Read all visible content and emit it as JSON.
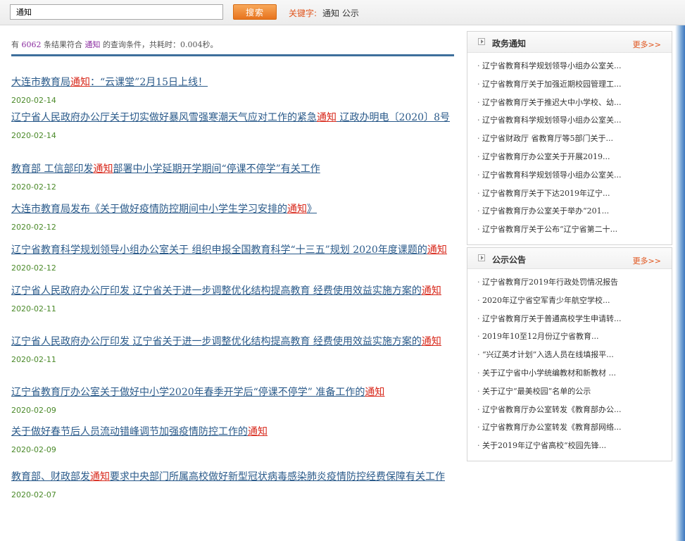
{
  "search": {
    "value": "通知",
    "button_label": "搜索",
    "keyword_label": "关键字:",
    "keyword_value": "通知 公示"
  },
  "summary": {
    "prefix": "有",
    "count": "6062",
    "middle": "条结果符合",
    "keyword": "通知",
    "suffix": "的查询条件，共耗时：0.004秒。"
  },
  "results": [
    {
      "pre": "大连市教育局",
      "hl": "通知",
      "post": "：“云课堂”2月15日上线！",
      "date": "2020-02-14"
    },
    {
      "pre": "辽宁省人民政府办公厅关于切实做好暴风雪强寒潮天气应对工作的紧急",
      "hl": "通知",
      "post": " 辽政办明电〔2020〕8号",
      "date": "2020-02-14"
    },
    {
      "pre": "教育部 工信部印发",
      "hl": "通知",
      "post": "部署中小学延期开学期间“停课不停学”有关工作",
      "date": "2020-02-12"
    },
    {
      "pre": "大连市教育局发布《关于做好疫情防控期间中小学生学习安排的",
      "hl": "通知",
      "post": "》",
      "date": "2020-02-12"
    },
    {
      "pre": "辽宁省教育科学规划领导小组办公室关于 组织申报全国教育科学“十三五”规划 2020年度课题的",
      "hl": "通知",
      "post": "",
      "date": "2020-02-12"
    },
    {
      "pre": "辽宁省人民政府办公厅印发 辽宁省关于进一步调整优化结构提高教育 经费使用效益实施方案的",
      "hl": "通知",
      "post": "",
      "date": "2020-02-11"
    },
    {
      "pre": "辽宁省人民政府办公厅印发 辽宁省关于进一步调整优化结构提高教育 经费使用效益实施方案的",
      "hl": "通知",
      "post": "",
      "date": "2020-02-11"
    },
    {
      "pre": "辽宁省教育厅办公室关于做好中小学2020年春季开学后“停课不停学” 准备工作的",
      "hl": "通知",
      "post": "",
      "date": "2020-02-09"
    },
    {
      "pre": "关于做好春节后人员流动错峰调节加强疫情防控工作的",
      "hl": "通知",
      "post": "",
      "date": "2020-02-09"
    },
    {
      "pre": "教育部、财政部发",
      "hl": "通知",
      "post": "要求中央部门所属高校做好新型冠状病毒感染肺炎疫情防控经费保障有关工作",
      "date": "2020-02-07"
    }
  ],
  "sidebar": {
    "gov": {
      "title": "政务通知",
      "more": "更多>>",
      "items": [
        "辽宁省教育科学规划领导小组办公室关...",
        "辽宁省教育厅关于加强近期校园管理工...",
        "辽宁省教育厅关于推迟大中小学校、幼...",
        "辽宁省教育科学规划领导小组办公室关...",
        "辽宁省财政厅 省教育厅等5部门关于...",
        "辽宁省教育厅办公室关于开展2019...",
        "辽宁省教育科学规划领导小组办公室关...",
        "辽宁省教育厅关于下达2019年辽宁...",
        "辽宁省教育厅办公室关于举办“201...",
        "辽宁省教育厅关于公布“辽宁省第二十..."
      ]
    },
    "notice": {
      "title": "公示公告",
      "more": "更多>>",
      "items": [
        "辽宁省教育厅2019年行政处罚情况报告",
        "2020年辽宁省空军青少年航空学校...",
        "辽宁省教育厅关于普通高校学生申请转...",
        "2019年10至12月份辽宁省教育...",
        "“兴辽英才计划”入选人员在线填报平...",
        "关于辽宁省中小学统编教材和新教材 ...",
        "关于辽宁“最美校园”名单的公示",
        "辽宁省教育厅办公室转发《教育部办公...",
        "辽宁省教育厅办公室转发《教育部网络...",
        "关于2019年辽宁省高校“校园先锋..."
      ]
    }
  }
}
